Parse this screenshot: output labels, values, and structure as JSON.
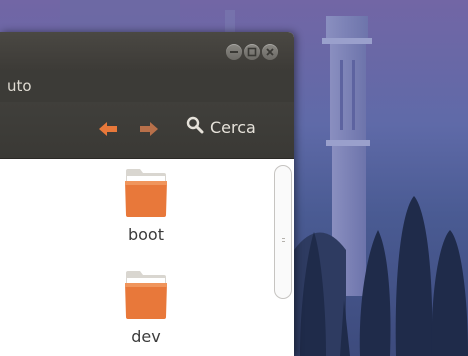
{
  "window": {
    "menu_label": "uto",
    "search_label": "Cerca"
  },
  "folders": [
    {
      "name": "boot"
    },
    {
      "name": "dev"
    }
  ],
  "colors": {
    "accent_orange": "#e8783a",
    "titlebar": "#3c3b37",
    "menu_text": "#dfdbd2"
  },
  "icons": [
    "minimize-icon",
    "maximize-icon",
    "close-icon",
    "back-arrow-icon",
    "forward-arrow-icon",
    "search-icon",
    "folder-icon"
  ]
}
